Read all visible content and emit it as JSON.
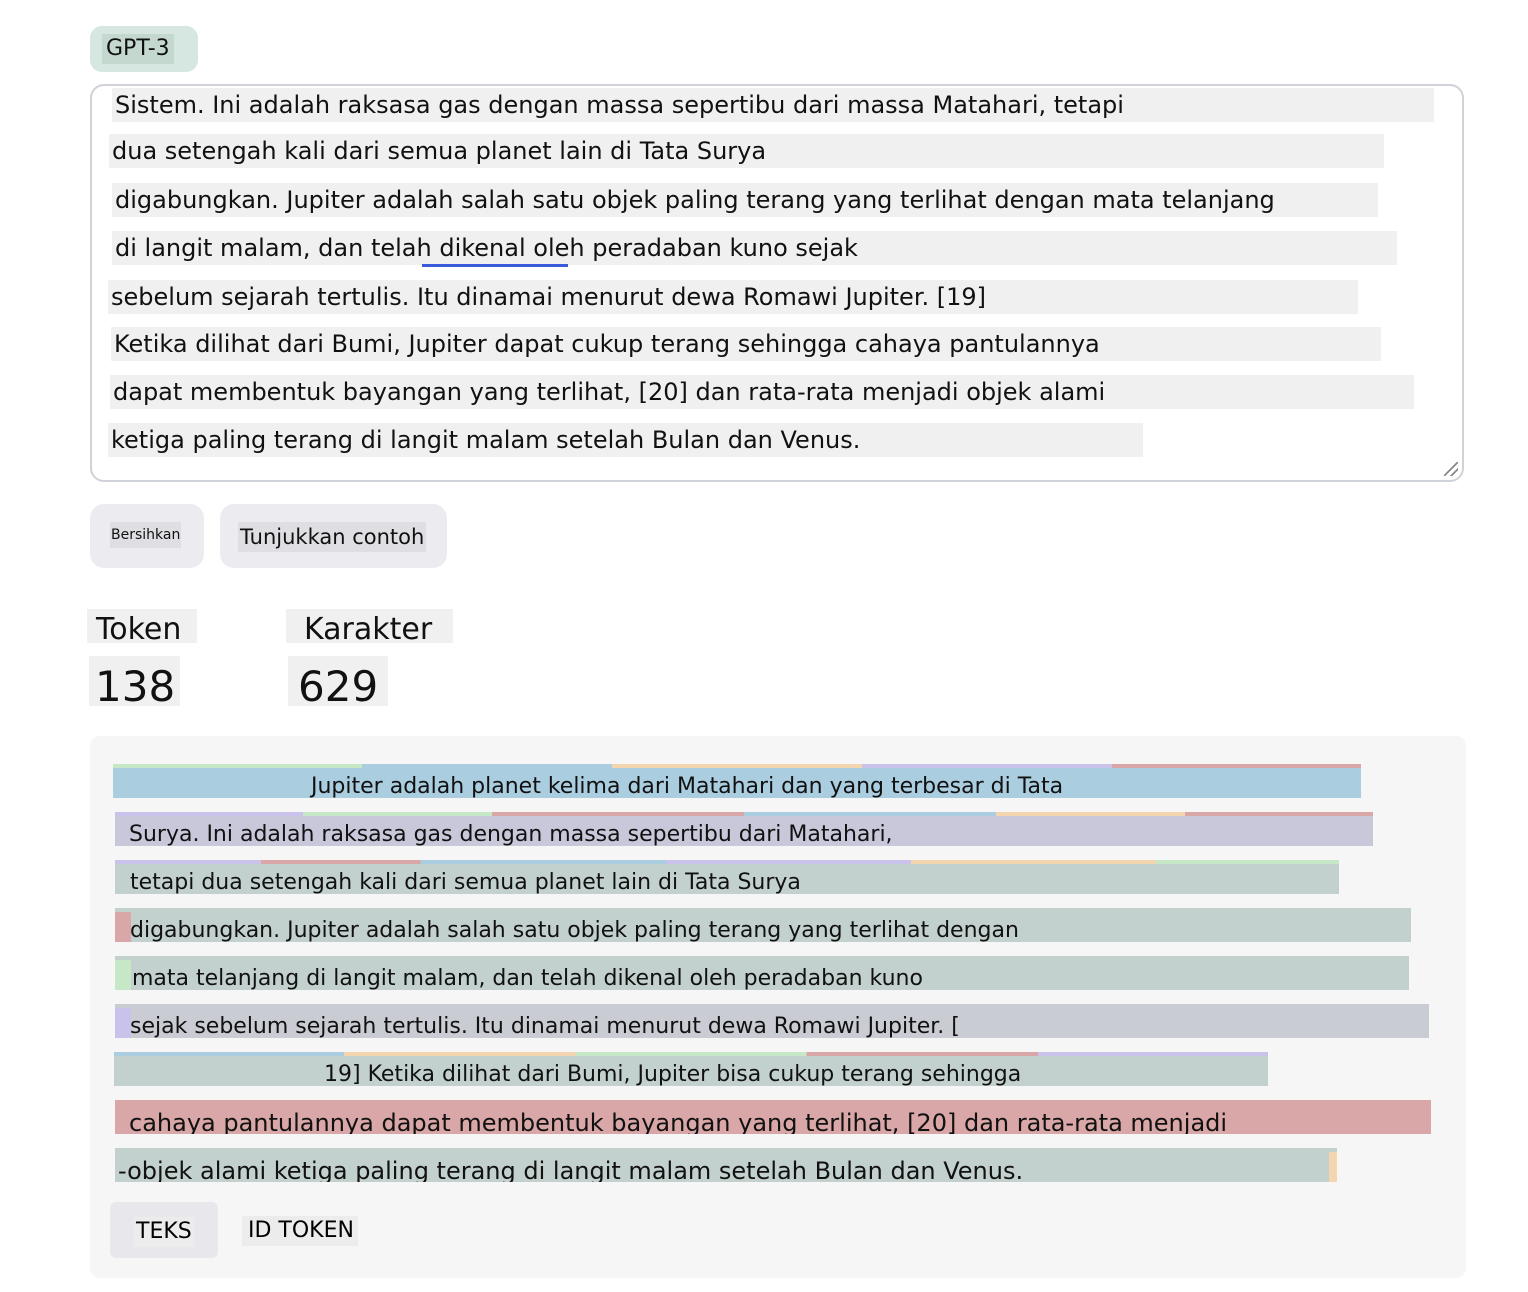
{
  "model": {
    "tab_label": "GPT-3"
  },
  "input": {
    "lines": [
      "Sistem. Ini adalah raksasa gas dengan massa sepertibu dari massa Matahari, tetapi",
      "dua setengah kali dari semua planet lain di Tata Surya",
      "digabungkan. Jupiter adalah salah satu objek paling terang yang terlihat dengan mata telanjang",
      "di langit malam, dan telah dikenal oleh peradaban kuno sejak",
      "sebelum sejarah tertulis. Itu dinamai menurut dewa Romawi Jupiter. [19]",
      "Ketika dilihat dari Bumi, Jupiter dapat cukup terang sehingga cahaya pantulannya",
      "dapat membentuk bayangan yang terlihat, [20] dan rata-rata menjadi objek alami",
      "ketiga paling terang di langit malam setelah Bulan dan Venus."
    ]
  },
  "buttons": {
    "clear": "Bersihkan",
    "example": "Tunjukkan contoh"
  },
  "stats": {
    "tokens_label": "Token",
    "tokens_value": "138",
    "chars_label": "Karakter",
    "chars_value": "629"
  },
  "output": {
    "lines": [
      "Jupiter adalah planet kelima dari Matahari dan yang terbesar di Tata",
      "Surya. Ini adalah raksasa gas dengan massa sepertibu dari Matahari,",
      "tetapi dua setengah kali dari semua planet lain di Tata Surya",
      "digabungkan. Jupiter adalah salah satu objek paling terang yang terlihat dengan",
      "mata telanjang di langit malam, dan telah dikenal oleh peradaban kuno",
      "sejak sebelum sejarah tertulis. Itu dinamai menurut dewa Romawi Jupiter. [",
      "19] Ketika dilihat dari Bumi, Jupiter bisa cukup terang sehingga",
      "cahaya pantulannya dapat membentuk bayangan yang terlihat, [20] dan rata-rata menjadi",
      "-objek alami ketiga paling terang di langit malam setelah Bulan dan Venus."
    ],
    "colors": {
      "blue": "#aacde0",
      "lavender": "#c9c8db",
      "teal": "#c3d1ce",
      "rose": "#d9a7a7",
      "peach": "#f3d5b0",
      "mint": "#c6e8c6",
      "purple": "#c9c2ea"
    }
  },
  "view_tabs": {
    "text": "TEKS",
    "token_ids": "ID TOKEN"
  }
}
